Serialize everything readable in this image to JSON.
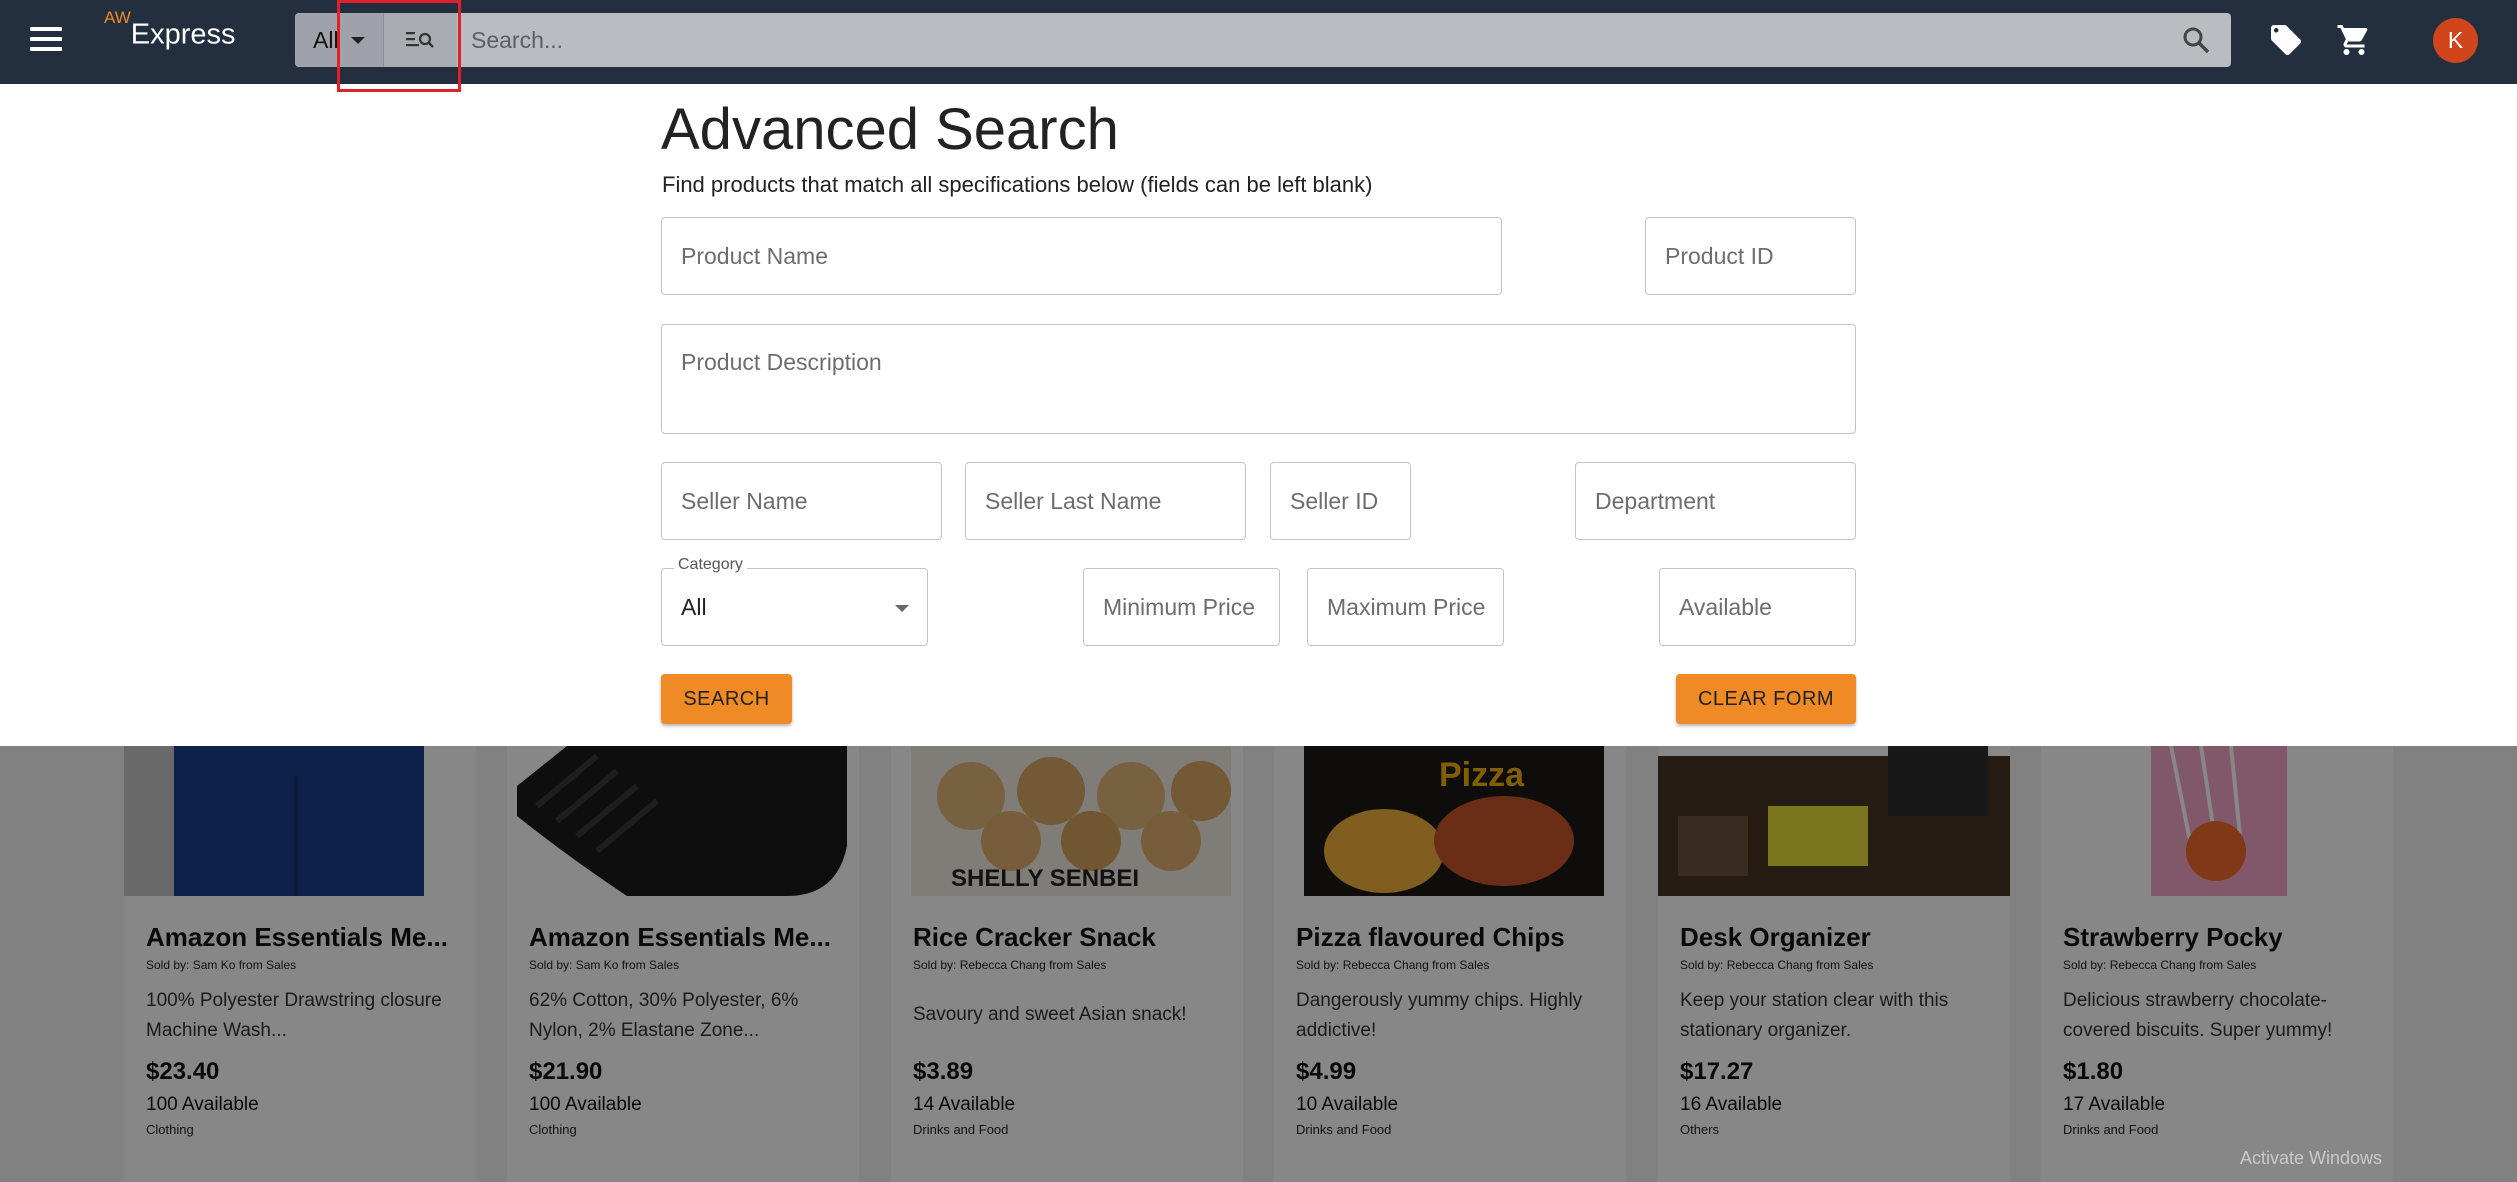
{
  "header": {
    "logo_super": "AW",
    "logo_text": "Express",
    "category_value": "All",
    "search_placeholder": "Search...",
    "avatar_letter": "K",
    "colors": {
      "bar": "#232f3e",
      "accent": "#f08a24",
      "highlight": "#e0202a",
      "avatar": "#d0451b"
    }
  },
  "advanced_search": {
    "title": "Advanced Search",
    "subtitle": "Find products that match all specifications below (fields can be left blank)",
    "fields": {
      "product_name": "Product Name",
      "product_id": "Product ID",
      "product_description": "Product Description",
      "seller_name": "Seller Name",
      "seller_last_name": "Seller Last Name",
      "seller_id": "Seller ID",
      "department": "Department",
      "category_label": "Category",
      "category_value": "All",
      "minimum_price": "Minimum Price",
      "maximum_price": "Maximum Price",
      "available": "Available"
    },
    "search_button": "SEARCH",
    "clear_button": "CLEAR FORM"
  },
  "products": [
    {
      "name": "Amazon Essentials Me...",
      "seller": "Sold by: Sam Ko from Sales",
      "desc": "100% Polyester Drawstring closure Machine Wash...",
      "price": "$23.40",
      "available": "100 Available",
      "category": "Clothing",
      "image": "shorts"
    },
    {
      "name": "Amazon Essentials Me...",
      "seller": "Sold by: Sam Ko from Sales",
      "desc": "62% Cotton, 30% Polyester, 6% Nylon, 2% Elastane Zone...",
      "price": "$21.90",
      "available": "100 Available",
      "category": "Clothing",
      "image": "socks"
    },
    {
      "name": "Rice Cracker Snack",
      "seller": "Sold by: Rebecca Chang from Sales",
      "desc": "Savoury and sweet Asian snack!",
      "price": "$3.89",
      "available": "14 Available",
      "category": "Drinks and Food",
      "image": "rice-crackers",
      "image_text": "SHELLY  SENBEI"
    },
    {
      "name": "Pizza flavoured Chips",
      "seller": "Sold by: Rebecca Chang from Sales",
      "desc": "Dangerously yummy chips. Highly addictive!",
      "price": "$4.99",
      "available": "10 Available",
      "category": "Drinks and Food",
      "image": "pizza-chips",
      "image_text": "Pizza"
    },
    {
      "name": "Desk Organizer",
      "seller": "Sold by: Rebecca Chang from Sales",
      "desc": "Keep your station clear with this stationary organizer.",
      "price": "$17.27",
      "available": "16 Available",
      "category": "Others",
      "image": "desk-organizer"
    },
    {
      "name": "Strawberry Pocky",
      "seller": "Sold by: Rebecca Chang from Sales",
      "desc": "Delicious strawberry chocolate-covered biscuits. Super yummy!",
      "price": "$1.80",
      "available": "17 Available",
      "category": "Drinks and Food",
      "image": "pocky"
    }
  ],
  "watermark": "Activate Windows"
}
